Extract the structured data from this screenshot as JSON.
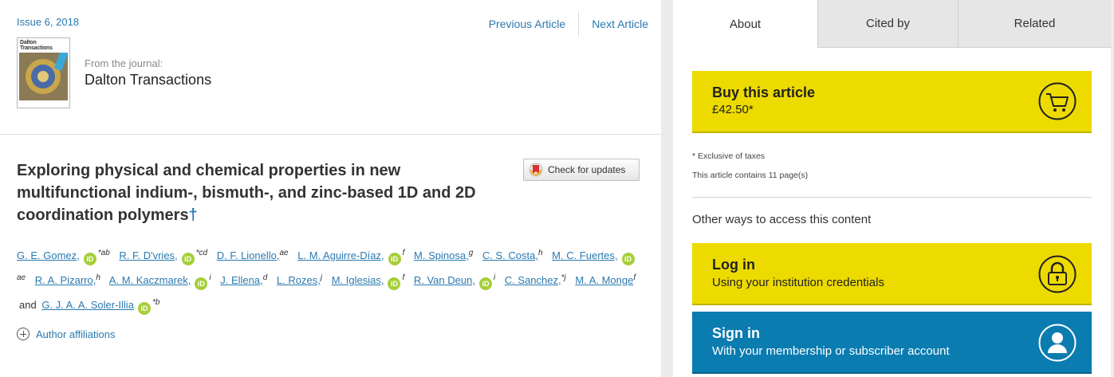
{
  "header": {
    "issue": "Issue 6, 2018",
    "previous_article": "Previous Article",
    "next_article": "Next Article",
    "from_journal": "From the journal:",
    "journal_name": "Dalton Transactions",
    "cover_title": "Dalton\nTransactions"
  },
  "article": {
    "title": "Exploring physical and chemical properties in new multifunctional indium-, bismuth-, and zinc-based 1D and 2D coordination polymers",
    "dagger": "†",
    "check_updates": "Check for updates",
    "orcid_label": "iD",
    "and_word": "and",
    "authors": [
      {
        "name": "G. E. Gomez,",
        "orcid": true,
        "sup": "*ab"
      },
      {
        "name": "R. F. D'vries,",
        "orcid": true,
        "sup": "*cd"
      },
      {
        "name": "D. F. Lionello,",
        "orcid": false,
        "sup": "ae"
      },
      {
        "name": "L. M. Aguirre-Díaz,",
        "orcid": true,
        "sup": "f"
      },
      {
        "name": "M. Spinosa,",
        "orcid": false,
        "sup": "g"
      },
      {
        "name": "C. S. Costa,",
        "orcid": false,
        "sup": "h"
      },
      {
        "name": "M. C. Fuertes,",
        "orcid": true,
        "sup": "ae"
      },
      {
        "name": "R. A. Pizarro,",
        "orcid": false,
        "sup": "h"
      },
      {
        "name": "A. M. Kaczmarek,",
        "orcid": true,
        "sup": "i"
      },
      {
        "name": "J. Ellena,",
        "orcid": false,
        "sup": "d"
      },
      {
        "name": "L. Rozes,",
        "orcid": false,
        "sup": "j"
      },
      {
        "name": "M. Iglesias,",
        "orcid": true,
        "sup": "f"
      },
      {
        "name": "R. Van Deun,",
        "orcid": true,
        "sup": "i"
      },
      {
        "name": "C. Sanchez,",
        "orcid": false,
        "sup": "*j"
      },
      {
        "name": "M. A. Monge",
        "orcid": false,
        "sup": "f"
      },
      {
        "name": "G. J. A. A. Soler-Illia",
        "orcid": true,
        "sup": "*b"
      }
    ],
    "author_affiliations": "Author affiliations"
  },
  "sidebar": {
    "tabs": [
      {
        "label": "About"
      },
      {
        "label": "Cited by"
      },
      {
        "label": "Related"
      }
    ],
    "buy": {
      "title": "Buy this article",
      "price": "£42.50*"
    },
    "note_taxes": "* Exclusive of taxes",
    "note_pages": "This article contains 11 page(s)",
    "other_ways": "Other ways to access this content",
    "login": {
      "title": "Log in",
      "subtitle": "Using your institution credentials"
    },
    "signin": {
      "title": "Sign in",
      "subtitle": "With your membership or subscriber account"
    }
  },
  "icons": {
    "cart": "cart-icon",
    "lock": "lock-icon",
    "user": "user-icon",
    "plus": "plus-circle-icon",
    "check_updates": "check-updates-icon",
    "orcid": "orcid-icon"
  },
  "colors": {
    "link": "#2a7ab0",
    "buy_yellow": "#eddb00",
    "signin_blue": "#0a7cb0",
    "orcid_green": "#a6ce39",
    "tab_inactive": "#e6e6e6"
  }
}
